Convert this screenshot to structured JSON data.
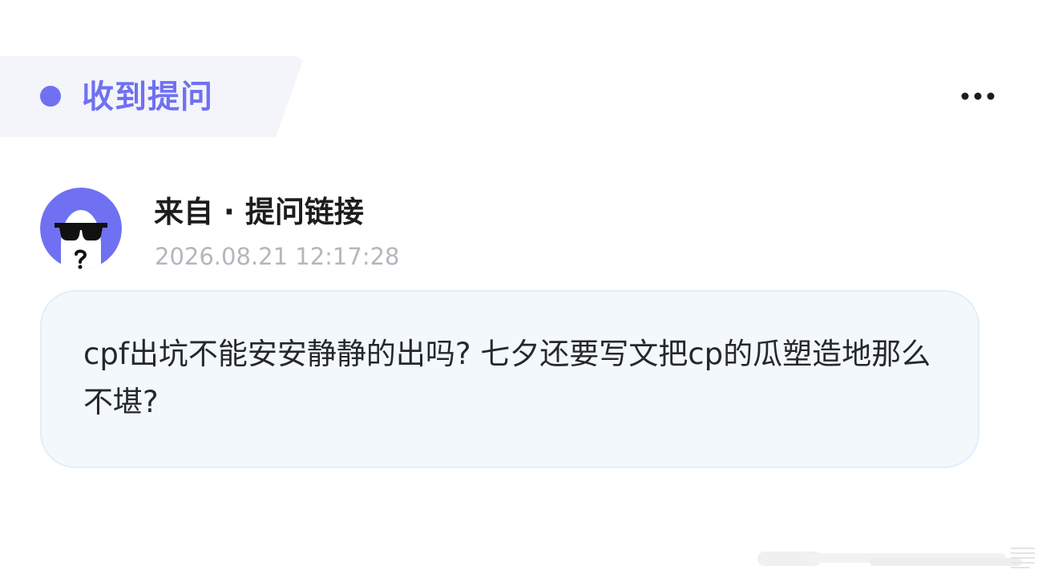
{
  "header": {
    "title": "收到提问"
  },
  "menu": {
    "icon": "more-horizontal-icon"
  },
  "message": {
    "avatar_icon": "sunglasses-face-avatar-icon",
    "sender": "来自 · 提问链接",
    "timestamp": "2026.08.21 12:17:28",
    "question": "cpf出坑不能安安静静的出吗? 七夕还要写文把cp的瓜塑造地那么不堪?"
  },
  "colors": {
    "accent": "#6f71f2",
    "header_bg": "#f4f5fb",
    "card_bg": "#f3f8fd",
    "timestamp": "#b3b7bd"
  }
}
